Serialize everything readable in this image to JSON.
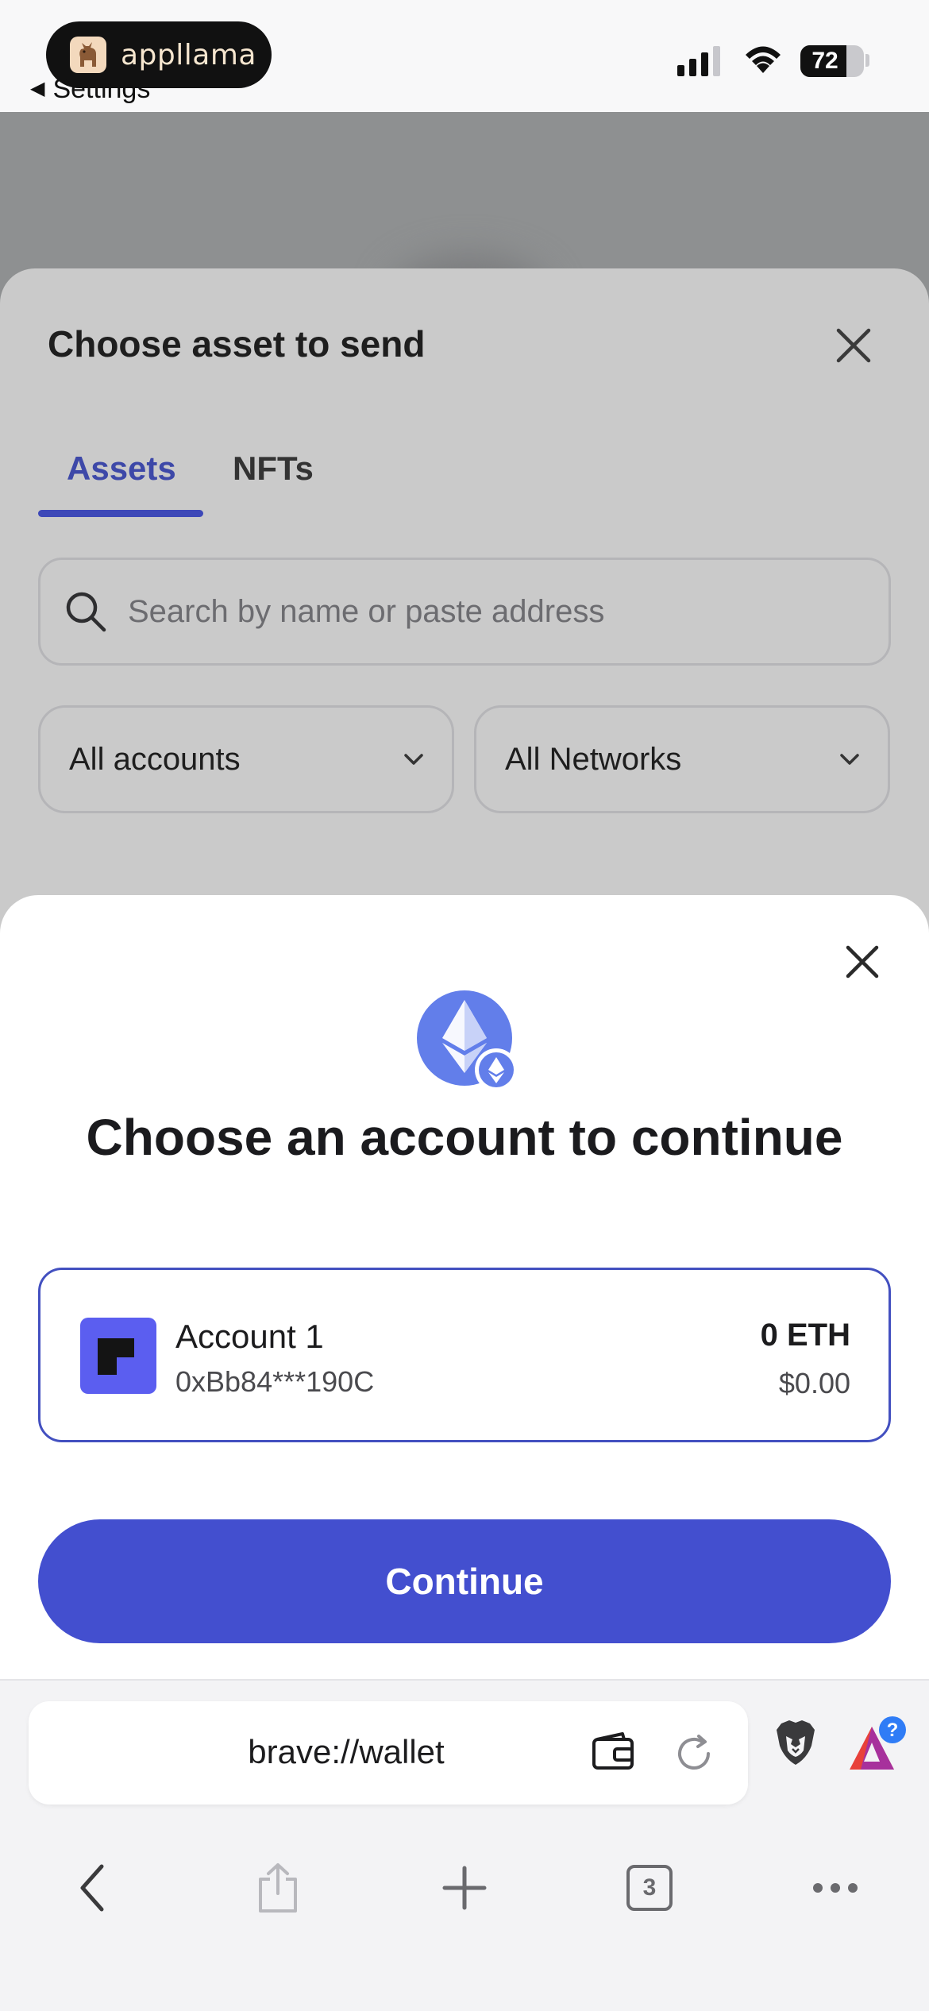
{
  "status_bar": {
    "app_badge": "appllama",
    "back_label": "Settings",
    "battery_percent": "72",
    "battery_level": 0.72,
    "signal_bars": 4,
    "signal_active": 3
  },
  "asset_sheet": {
    "title": "Choose asset to send",
    "tabs": [
      {
        "label": "Assets",
        "active": true
      },
      {
        "label": "NFTs",
        "active": false
      }
    ],
    "search_placeholder": "Search by name or paste address",
    "filter_accounts": "All accounts",
    "filter_networks": "All Networks"
  },
  "account_modal": {
    "title": "Choose an account to continue",
    "account": {
      "name": "Account 1",
      "address": "0xBb84***190C",
      "balance": "0 ETH",
      "balance_usd": "$0.00"
    },
    "continue_label": "Continue"
  },
  "toolbar": {
    "url": "brave://wallet",
    "tab_count": "3",
    "rewards_badge": "?"
  },
  "colors": {
    "accent": "#434fcf",
    "tab_active": "#3d48a8",
    "avatar": "#5b5ef0",
    "eth_blue": "#627eea"
  }
}
